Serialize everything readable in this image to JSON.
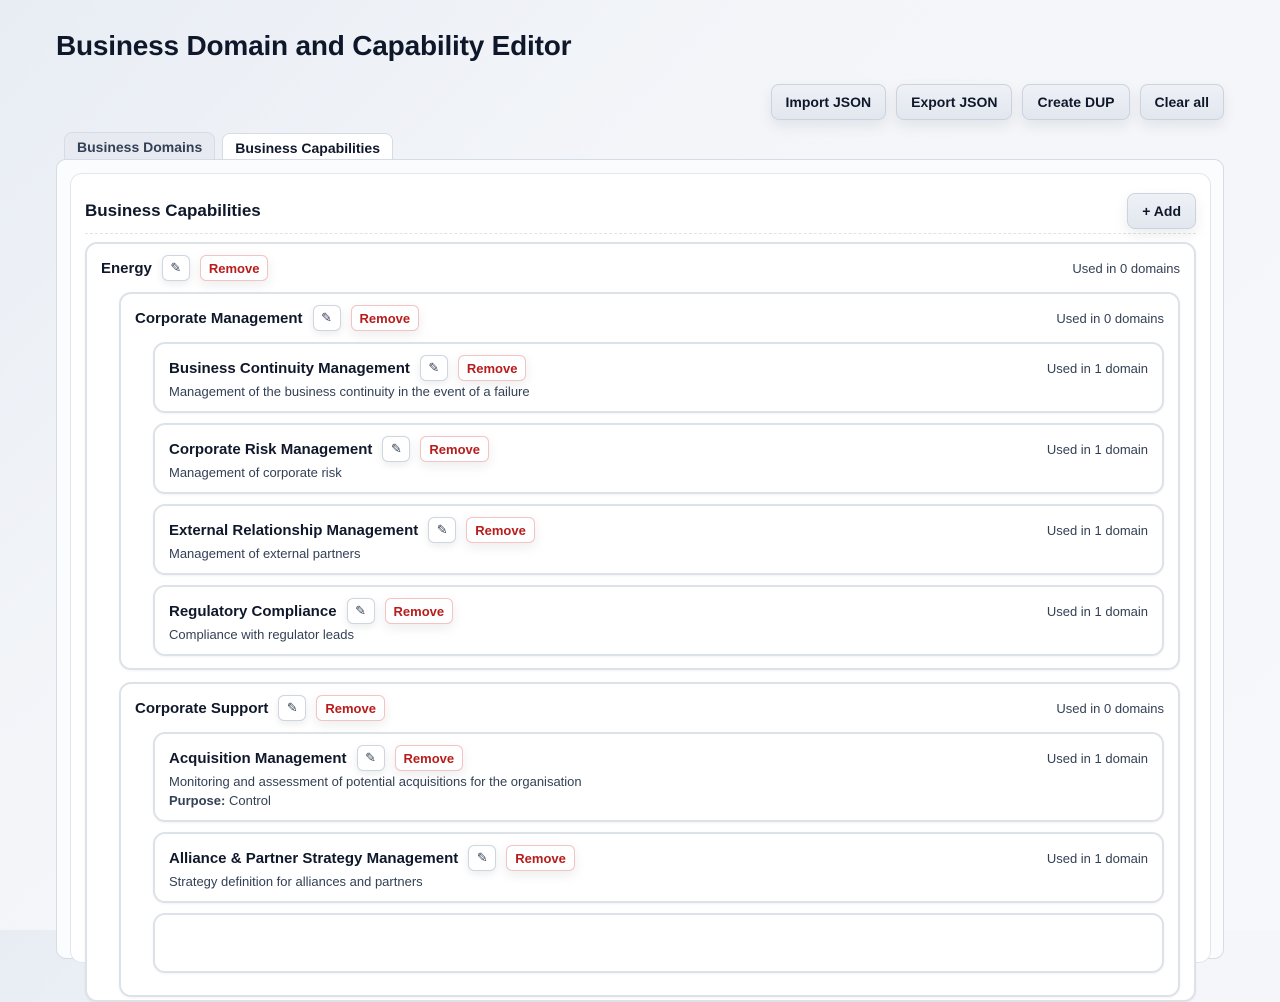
{
  "page": {
    "title": "Business Domain and Capability Editor"
  },
  "toolbar": {
    "import_label": "Import JSON",
    "export_label": "Export JSON",
    "create_dup_label": "Create DUP",
    "clear_label": "Clear all"
  },
  "tabs": [
    {
      "label": "Business Domains",
      "active": false
    },
    {
      "label": "Business Capabilities",
      "active": true
    }
  ],
  "panel": {
    "title": "Business Capabilities",
    "add_label": "+ Add"
  },
  "common": {
    "edit_glyph": "✎",
    "remove_label": "Remove",
    "purpose_label": "Purpose:"
  },
  "tree": {
    "name": "Energy",
    "usage": "Used in 0 domains",
    "groups": [
      {
        "name": "Corporate Management",
        "usage": "Used in 0 domains",
        "items": [
          {
            "name": "Business Continuity Management",
            "usage": "Used in 1 domain",
            "description": "Management of the business continuity in the event of a failure"
          },
          {
            "name": "Corporate Risk Management",
            "usage": "Used in 1 domain",
            "description": "Management of corporate risk"
          },
          {
            "name": "External Relationship Management",
            "usage": "Used in 1 domain",
            "description": "Management of external partners"
          },
          {
            "name": "Regulatory Compliance",
            "usage": "Used in 1 domain",
            "description": "Compliance with regulator leads"
          }
        ]
      },
      {
        "name": "Corporate Support",
        "usage": "Used in 0 domains",
        "items": [
          {
            "name": "Acquisition Management",
            "usage": "Used in 1 domain",
            "description": "Monitoring and assessment of potential acquisitions for the organisation",
            "purpose": "Control"
          },
          {
            "name": "Alliance & Partner Strategy Management",
            "usage": "Used in 1 domain",
            "description": "Strategy definition for alliances and partners"
          }
        ]
      }
    ]
  },
  "icons": {
    "edit": "pencil-icon"
  }
}
